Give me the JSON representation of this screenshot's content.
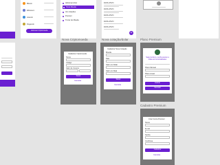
{
  "labels": {
    "nova_criptomoeda": "Nova Criptomoeda",
    "nova_cotacao": "Nova cotação/dolar",
    "plano_premium": "Plano Premium",
    "cadastro_premium": "Cadastro Premium"
  },
  "coins": [
    {
      "name": "Bitcoin",
      "color": "#f7931a"
    },
    {
      "name": "Ethereum",
      "color": "#6a7bd1"
    },
    {
      "name": "Litecoin",
      "color": "#3c8fd9"
    },
    {
      "name": "Dogecoin",
      "color": "#c2a633"
    }
  ],
  "wallet_button": "Adicionar Criptomoeda",
  "menu": {
    "items": [
      "Adicionar Ativo",
      "Nova Moeda",
      "Ver cotações",
      "Premium",
      "Trocar de Moeda"
    ]
  },
  "tx_panel": {
    "items": [
      "DATA ATIVO",
      "DATA ATIVO",
      "DATA ATIVO",
      "DATA ATIVO",
      "DATA ATIVO",
      "DATA ATIVO"
    ]
  },
  "add_btn": "Adicionar Criptomoeda",
  "form1": {
    "title": "Cadastrar Criptomoeda",
    "fields": [
      "Nome",
      "Código",
      "Valor de Compra",
      "Quantidade"
    ],
    "submit": "Salvar",
    "cancel": "Cancelar"
  },
  "form2": {
    "title": "Cadastrar Nova Cotação",
    "fields": [
      "Moeda",
      "Data",
      "Valor em Dolar",
      "Valor em Real"
    ],
    "submit": "Salvar",
    "cancel": "Cancelar"
  },
  "premium": {
    "heading": "Seja premium e tenha acesso a todas as funcionalidades",
    "rows": [
      "Plano Mensal",
      "Plano Anual"
    ],
    "submit": "Assinar",
    "cancel": "Cancelar"
  },
  "signup": {
    "title": "Criar Conta Premium",
    "fields": [
      "Nome",
      "E-mail",
      "Senha",
      "Confirmar"
    ],
    "submit": "Cadastrar",
    "cancel": "Cancelar"
  },
  "colors": {
    "accent": "#6a1fd1",
    "frame": "#777777"
  }
}
